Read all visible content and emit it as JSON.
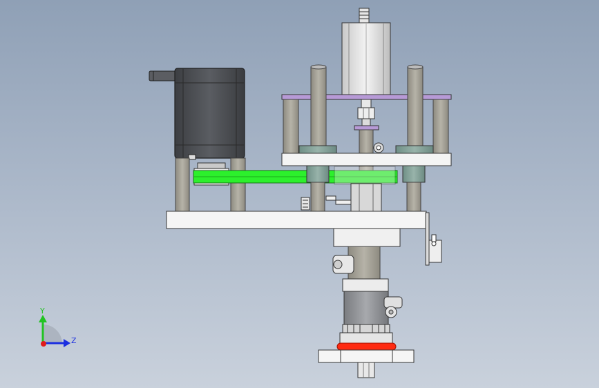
{
  "viewport": {
    "background_top": "#8fa0b6",
    "background_bottom": "#c9d1dc"
  },
  "triad": {
    "y_label": "Y",
    "z_label": "Z",
    "y_color": "#22c322",
    "z_color": "#1b2fe0",
    "x_color": "#e01b1b"
  },
  "model": {
    "belt_color": "#2cf02c",
    "bracket_color": "#b79ad6",
    "pad_color": "#ff2a10",
    "motor_color": "#4a4c50",
    "post_color": "#a8a59a"
  }
}
